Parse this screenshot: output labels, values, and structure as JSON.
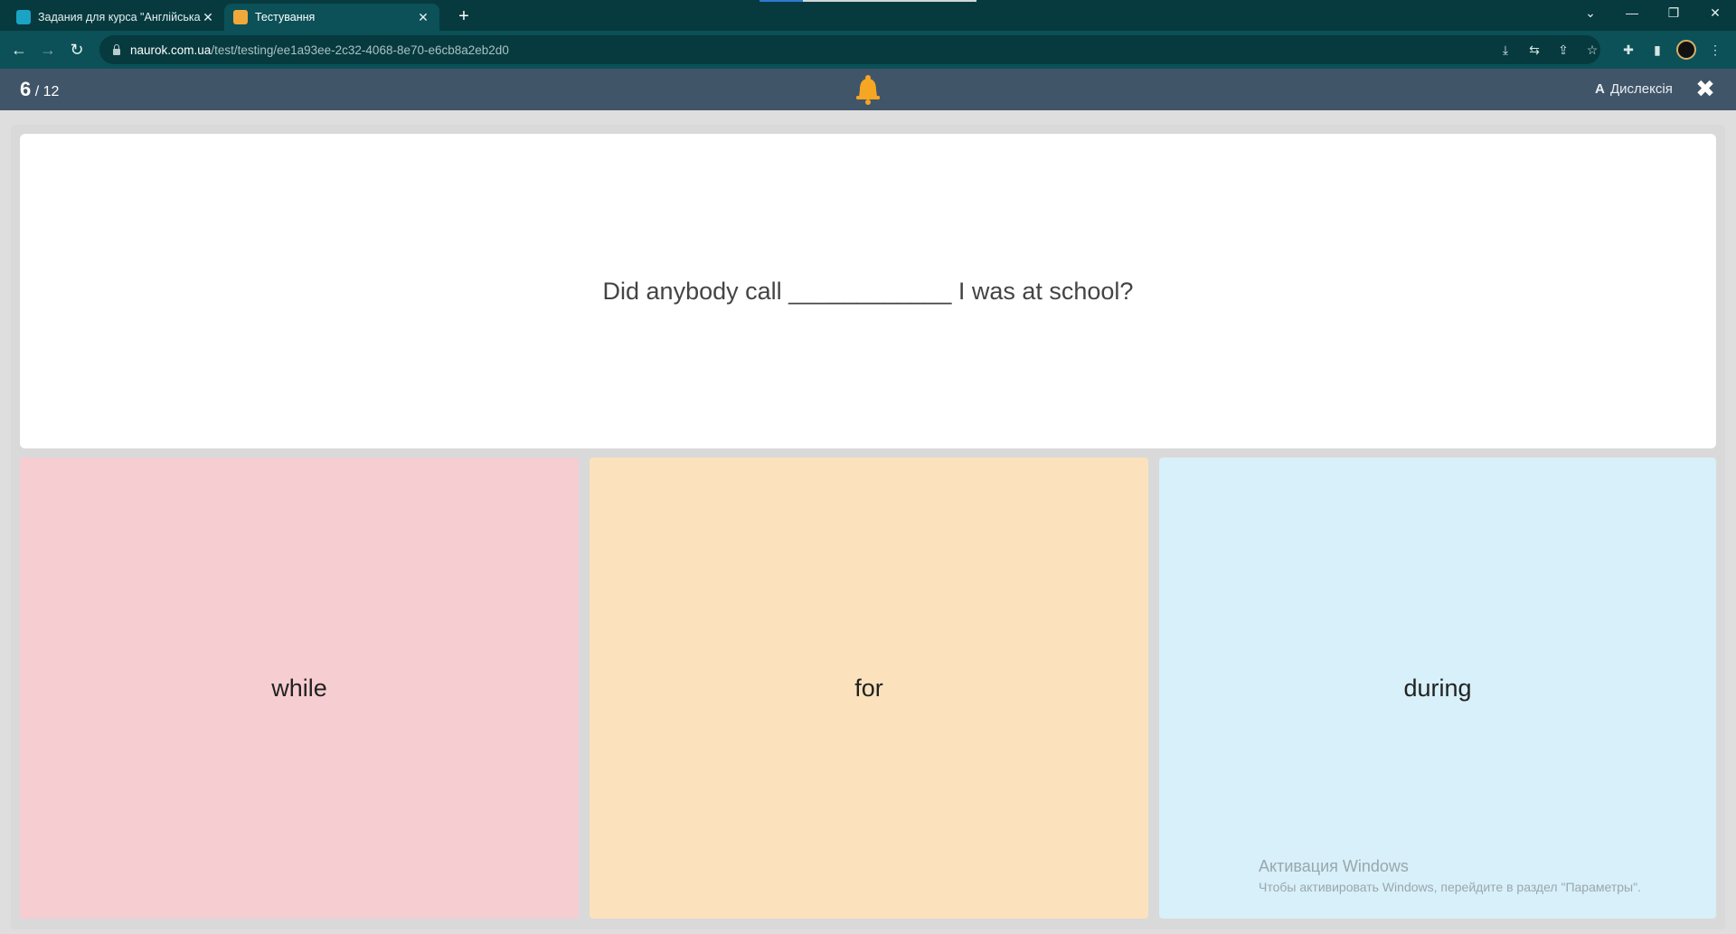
{
  "browser": {
    "tabs": [
      {
        "title": "Задания для курса \"Англійська",
        "active": false
      },
      {
        "title": "Тестування",
        "active": true
      }
    ],
    "new_tab_label": "+",
    "url_host": "naurok.com.ua",
    "url_path": "/test/testing/ee1a93ee-2c32-4068-8e70-e6cb8a2eb2d0"
  },
  "quiz": {
    "current": "6",
    "total": "/ 12",
    "dyslexia_label": "Дислексія",
    "question": "Did anybody call ____________ I was at school?",
    "options": [
      {
        "label": "while",
        "color": "#f6cdd0"
      },
      {
        "label": "for",
        "color": "#fbe2bc"
      },
      {
        "label": "during",
        "color": "#d7f0f9"
      }
    ]
  },
  "watermark": {
    "title": "Активация Windows",
    "subtitle": "Чтобы активировать Windows, перейдите в раздел \"Параметры\"."
  },
  "colors": {
    "tabstrip": "#063a3f",
    "toolbar": "#0b5157",
    "appbar": "#415569",
    "bell": "#f5a623"
  }
}
